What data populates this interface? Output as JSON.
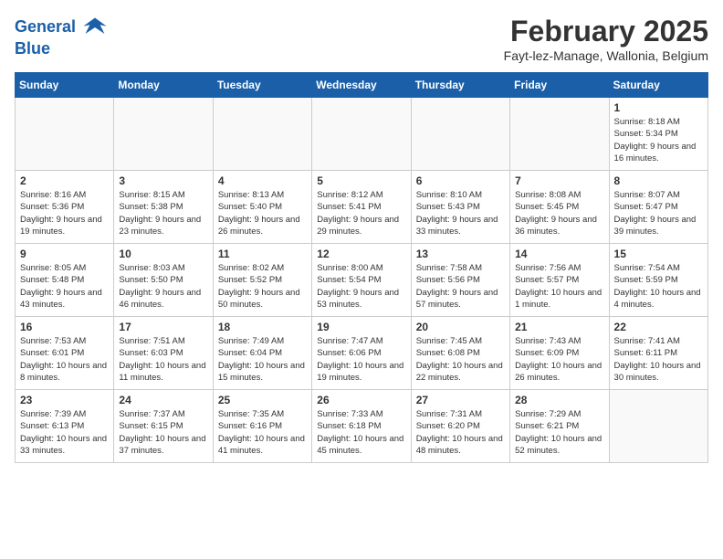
{
  "header": {
    "logo_line1": "General",
    "logo_line2": "Blue",
    "month": "February 2025",
    "location": "Fayt-lez-Manage, Wallonia, Belgium"
  },
  "weekdays": [
    "Sunday",
    "Monday",
    "Tuesday",
    "Wednesday",
    "Thursday",
    "Friday",
    "Saturday"
  ],
  "weeks": [
    [
      {
        "day": "",
        "info": ""
      },
      {
        "day": "",
        "info": ""
      },
      {
        "day": "",
        "info": ""
      },
      {
        "day": "",
        "info": ""
      },
      {
        "day": "",
        "info": ""
      },
      {
        "day": "",
        "info": ""
      },
      {
        "day": "1",
        "info": "Sunrise: 8:18 AM\nSunset: 5:34 PM\nDaylight: 9 hours and 16 minutes."
      }
    ],
    [
      {
        "day": "2",
        "info": "Sunrise: 8:16 AM\nSunset: 5:36 PM\nDaylight: 9 hours and 19 minutes."
      },
      {
        "day": "3",
        "info": "Sunrise: 8:15 AM\nSunset: 5:38 PM\nDaylight: 9 hours and 23 minutes."
      },
      {
        "day": "4",
        "info": "Sunrise: 8:13 AM\nSunset: 5:40 PM\nDaylight: 9 hours and 26 minutes."
      },
      {
        "day": "5",
        "info": "Sunrise: 8:12 AM\nSunset: 5:41 PM\nDaylight: 9 hours and 29 minutes."
      },
      {
        "day": "6",
        "info": "Sunrise: 8:10 AM\nSunset: 5:43 PM\nDaylight: 9 hours and 33 minutes."
      },
      {
        "day": "7",
        "info": "Sunrise: 8:08 AM\nSunset: 5:45 PM\nDaylight: 9 hours and 36 minutes."
      },
      {
        "day": "8",
        "info": "Sunrise: 8:07 AM\nSunset: 5:47 PM\nDaylight: 9 hours and 39 minutes."
      }
    ],
    [
      {
        "day": "9",
        "info": "Sunrise: 8:05 AM\nSunset: 5:48 PM\nDaylight: 9 hours and 43 minutes."
      },
      {
        "day": "10",
        "info": "Sunrise: 8:03 AM\nSunset: 5:50 PM\nDaylight: 9 hours and 46 minutes."
      },
      {
        "day": "11",
        "info": "Sunrise: 8:02 AM\nSunset: 5:52 PM\nDaylight: 9 hours and 50 minutes."
      },
      {
        "day": "12",
        "info": "Sunrise: 8:00 AM\nSunset: 5:54 PM\nDaylight: 9 hours and 53 minutes."
      },
      {
        "day": "13",
        "info": "Sunrise: 7:58 AM\nSunset: 5:56 PM\nDaylight: 9 hours and 57 minutes."
      },
      {
        "day": "14",
        "info": "Sunrise: 7:56 AM\nSunset: 5:57 PM\nDaylight: 10 hours and 1 minute."
      },
      {
        "day": "15",
        "info": "Sunrise: 7:54 AM\nSunset: 5:59 PM\nDaylight: 10 hours and 4 minutes."
      }
    ],
    [
      {
        "day": "16",
        "info": "Sunrise: 7:53 AM\nSunset: 6:01 PM\nDaylight: 10 hours and 8 minutes."
      },
      {
        "day": "17",
        "info": "Sunrise: 7:51 AM\nSunset: 6:03 PM\nDaylight: 10 hours and 11 minutes."
      },
      {
        "day": "18",
        "info": "Sunrise: 7:49 AM\nSunset: 6:04 PM\nDaylight: 10 hours and 15 minutes."
      },
      {
        "day": "19",
        "info": "Sunrise: 7:47 AM\nSunset: 6:06 PM\nDaylight: 10 hours and 19 minutes."
      },
      {
        "day": "20",
        "info": "Sunrise: 7:45 AM\nSunset: 6:08 PM\nDaylight: 10 hours and 22 minutes."
      },
      {
        "day": "21",
        "info": "Sunrise: 7:43 AM\nSunset: 6:09 PM\nDaylight: 10 hours and 26 minutes."
      },
      {
        "day": "22",
        "info": "Sunrise: 7:41 AM\nSunset: 6:11 PM\nDaylight: 10 hours and 30 minutes."
      }
    ],
    [
      {
        "day": "23",
        "info": "Sunrise: 7:39 AM\nSunset: 6:13 PM\nDaylight: 10 hours and 33 minutes."
      },
      {
        "day": "24",
        "info": "Sunrise: 7:37 AM\nSunset: 6:15 PM\nDaylight: 10 hours and 37 minutes."
      },
      {
        "day": "25",
        "info": "Sunrise: 7:35 AM\nSunset: 6:16 PM\nDaylight: 10 hours and 41 minutes."
      },
      {
        "day": "26",
        "info": "Sunrise: 7:33 AM\nSunset: 6:18 PM\nDaylight: 10 hours and 45 minutes."
      },
      {
        "day": "27",
        "info": "Sunrise: 7:31 AM\nSunset: 6:20 PM\nDaylight: 10 hours and 48 minutes."
      },
      {
        "day": "28",
        "info": "Sunrise: 7:29 AM\nSunset: 6:21 PM\nDaylight: 10 hours and 52 minutes."
      },
      {
        "day": "",
        "info": ""
      }
    ]
  ]
}
